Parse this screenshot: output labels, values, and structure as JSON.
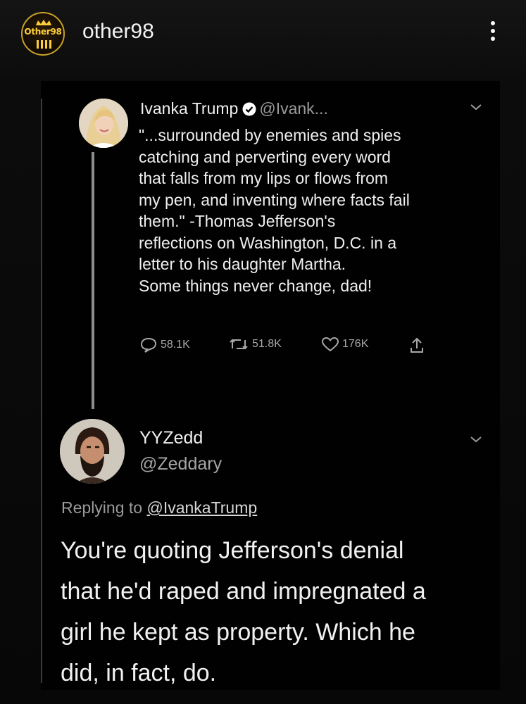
{
  "header": {
    "username": "other98",
    "badge_text": "Other98",
    "menu_icon": "more-vertical-icon",
    "accent": "#ffcf3a"
  },
  "tweet1": {
    "name": "Ivanka Trump",
    "handle": "@Ivank...",
    "verified_color": "#ffffff",
    "text": "\"...surrounded by enemies and spies\ncatching and perverting every word\nthat falls from my lips or flows from\nmy pen, and inventing where facts fail\nthem.\" -Thomas Jefferson's\nreflections on Washington, D.C. in a\nletter to his daughter Martha.\nSome things never change, dad!",
    "actions": {
      "replies": "58.1K",
      "retweets": "51.8K",
      "likes": "176K"
    }
  },
  "tweet2": {
    "name": "YYZedd",
    "handle": "@Zeddary",
    "replying_prefix": "Replying to",
    "replying_to": "@IvankaTrump",
    "text": "You're quoting Jefferson's denial\nthat he'd raped and impregnated a\ngirl he kept as property. Which he\ndid, in fact, do."
  }
}
